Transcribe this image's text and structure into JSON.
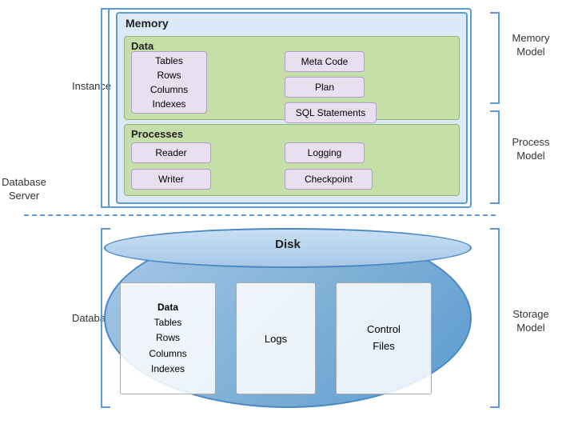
{
  "labels": {
    "database_server": "Database Server",
    "instance": "Instance",
    "database": "Database",
    "memory_model": "Memory Model",
    "process_model": "Process Model",
    "storage_model": "Storage Model"
  },
  "memory": {
    "title": "Memory",
    "data_section": {
      "title": "Data",
      "tables_box": {
        "lines": [
          "Tables",
          "Rows",
          "Columns",
          "Indexes"
        ]
      },
      "meta_code": "Meta Code",
      "plan": "Plan",
      "sql_statements": "SQL Statements"
    },
    "processes_section": {
      "title": "Processes",
      "reader": "Reader",
      "logging": "Logging",
      "writer": "Writer",
      "checkpoint": "Checkpoint"
    }
  },
  "disk": {
    "title": "Disk",
    "data_box": {
      "lines": [
        "Data",
        "Tables",
        "Rows",
        "Columns",
        "Indexes"
      ]
    },
    "logs": "Logs",
    "control_files_lines": [
      "Control",
      "Files"
    ]
  }
}
